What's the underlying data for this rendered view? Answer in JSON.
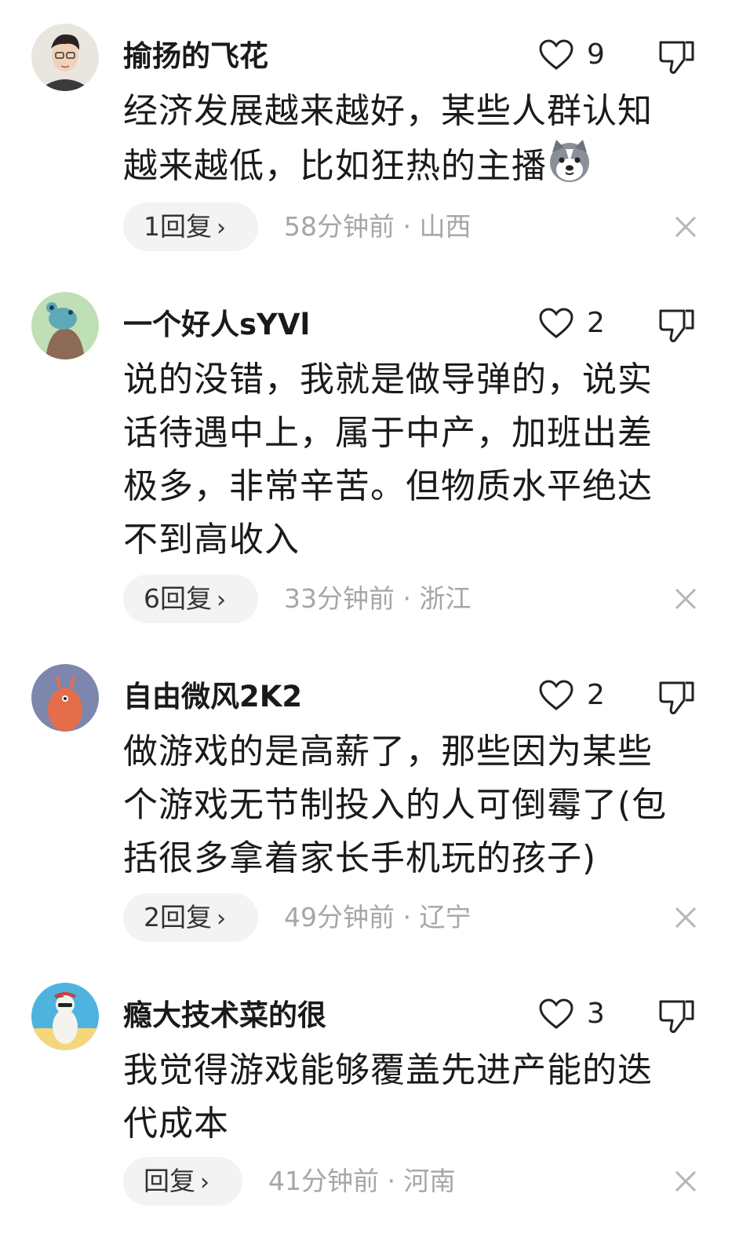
{
  "comments": [
    {
      "username": "揄扬的飞花",
      "likes": "9",
      "lines": [
        "经济发展越来越好，某些人群认知",
        "越来越低，比如狂热的主播"
      ],
      "reply_label": "1回复",
      "meta": "58分钟前 · 山西",
      "emoji": "dog-face-emoji"
    },
    {
      "username": "一个好人sYVl",
      "likes": "2",
      "lines": [
        "说的没错，我就是做导弹的，说实",
        "话待遇中上，属于中产，加班出差",
        "极多，非常辛苦。但物质水平绝达",
        "不到高收入"
      ],
      "reply_label": "6回复",
      "meta": "33分钟前 · 浙江"
    },
    {
      "username": "自由微风2K2",
      "likes": "2",
      "lines": [
        "做游戏的是高薪了，那些因为某些",
        "个游戏无节制投入的人可倒霉了(包",
        "括很多拿着家长手机玩的孩子)"
      ],
      "reply_label": "2回复",
      "meta": "49分钟前 · 辽宁"
    },
    {
      "username": "瘾大技术菜的很",
      "likes": "3",
      "lines": [
        "我觉得游戏能够覆盖先进产能的迭",
        "代成本"
      ],
      "reply_label": "回复",
      "meta": "41分钟前 · 河南"
    }
  ],
  "icons": {
    "like": "heart-outline-icon",
    "dislike": "thumbs-down-outline-icon",
    "close": "close-icon",
    "chevron": "chevron-right-icon"
  },
  "colors": {
    "text": "#1a1a1a",
    "meta": "#a6a6a6",
    "pill": "#f3f3f3"
  }
}
